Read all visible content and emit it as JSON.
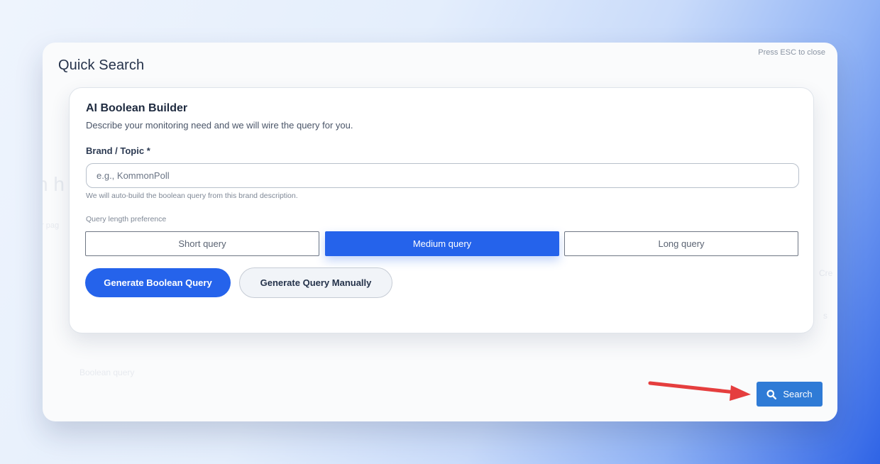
{
  "modal": {
    "title": "Quick Search",
    "esc_hint": "Press ESC to close"
  },
  "builder": {
    "title": "AI Boolean Builder",
    "subtitle": "Describe your monitoring need and we will wire the query for you.",
    "brand_label": "Brand / Topic *",
    "brand_placeholder": "e.g., KommonPoll",
    "brand_value": "",
    "help_text": "We will auto-build the boolean query from this brand description.",
    "pref_label": "Query length preference",
    "options": [
      {
        "label": "Short query",
        "selected": false
      },
      {
        "label": "Medium query",
        "selected": true
      },
      {
        "label": "Long query",
        "selected": false
      }
    ],
    "generate_label": "Generate Boolean Query",
    "manual_label": "Generate Query Manually"
  },
  "footer": {
    "search_label": "Search",
    "search_icon": "search-icon"
  },
  "annotation": {
    "arrow_color": "#e53e3e",
    "arrow_icon": "red-arrow-annotation"
  },
  "colors": {
    "accent": "#2563eb",
    "search_button": "#2f7bd6"
  }
}
